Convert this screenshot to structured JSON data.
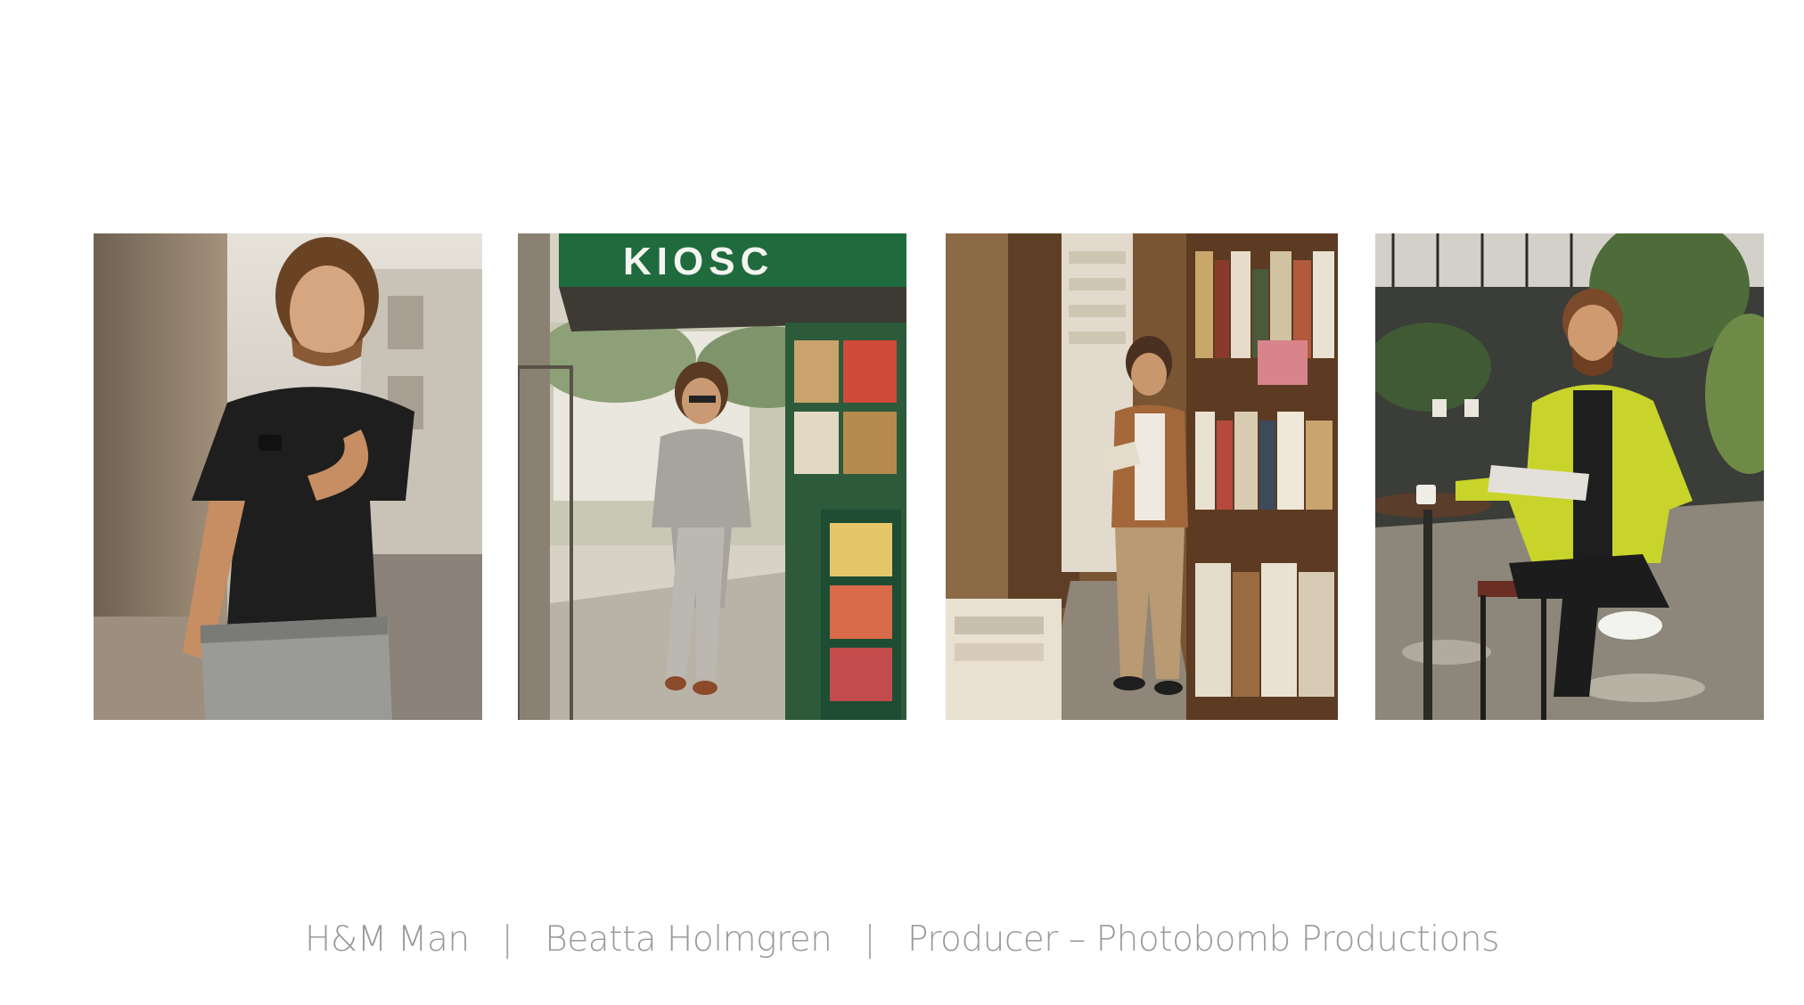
{
  "photos": [
    {
      "id": "photo-1",
      "alt": "Man in black t-shirt on a city street"
    },
    {
      "id": "photo-2",
      "alt": "Man in grey check suit leaning at a newsstand kiosk"
    },
    {
      "id": "photo-3",
      "alt": "Man in brown jacket reading in a bookstore alley"
    },
    {
      "id": "photo-4",
      "alt": "Man in lime jacket with newspaper at a cafe table"
    }
  ],
  "kiosk_sign": "KIOSC",
  "caption": {
    "client": "H&M Man",
    "separator": "|",
    "photographer": "Beatta Holmgren",
    "role": "Producer – Photobomb Productions"
  }
}
